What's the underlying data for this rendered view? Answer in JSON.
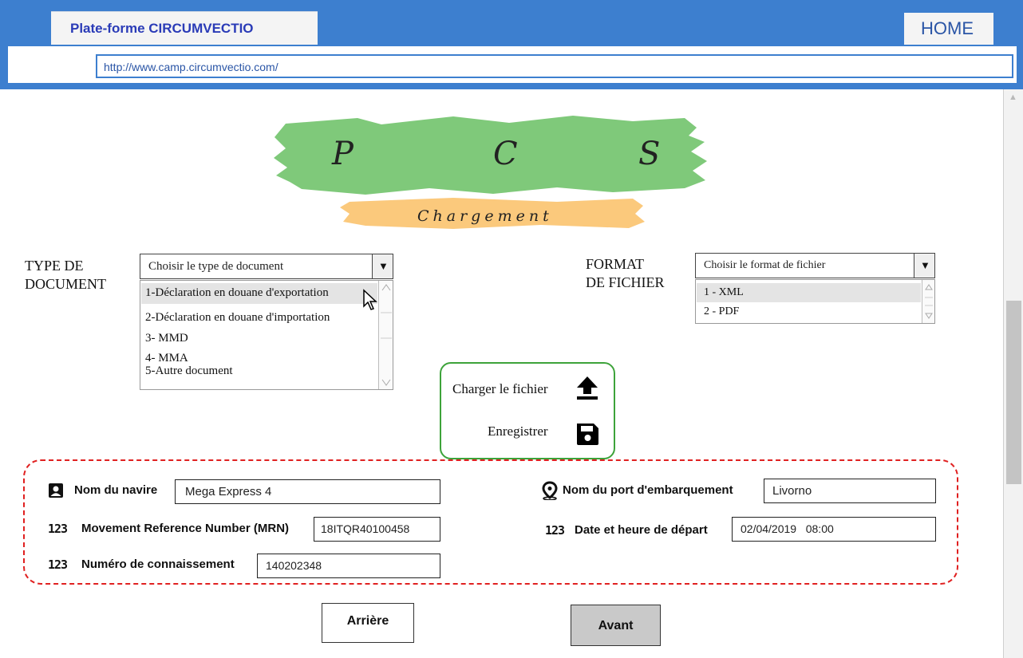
{
  "browser": {
    "tab_title": "Plate-forme CIRCUMVECTIO",
    "home_tab": "HOME",
    "url": "http://www.camp.circumvectio.com/"
  },
  "logo": {
    "letters": [
      "P",
      "C",
      "S"
    ],
    "subtitle": "Chargement",
    "green_color": "#7fc97a",
    "orange_color": "#fbc97c"
  },
  "type_document": {
    "label_line1": "TYPE DE",
    "label_line2": "DOCUMENT",
    "placeholder": "Choisir le type de document",
    "options": [
      "1-Déclaration en douane d'exportation",
      "2-Déclaration en douane d'importation",
      "3- MMD",
      "4- MMA",
      "5-Autre document"
    ],
    "highlighted_index": 0
  },
  "format_fichier": {
    "label_line1": "FORMAT",
    "label_line2": "DE FICHIER",
    "placeholder": "Choisir le format de fichier",
    "options": [
      "1 - XML",
      "2 - PDF"
    ],
    "highlighted_index": 0
  },
  "actions": {
    "upload_label": "Charger le fichier",
    "save_label": "Enregistrer",
    "upload_icon": "upload-icon",
    "save_icon": "floppy-disk-icon",
    "border_color": "#3da33a"
  },
  "form": {
    "nom_navire_label": "Nom du navire",
    "nom_navire_value": "Mega Express 4",
    "mrn_label": "Movement Reference Number (MRN)",
    "mrn_value": "18ITQR40100458",
    "connaissement_label": "Numéro de connaissement",
    "connaissement_value": "140202348",
    "port_label": "Nom du port d'embarquement",
    "port_value": "Livorno",
    "date_label": "Date et heure de départ",
    "date_value": "02/04/2019   08:00",
    "num_icon_text": "123",
    "border_color": "#e02020"
  },
  "buttons": {
    "back": "Arrière",
    "next": "Avant"
  }
}
